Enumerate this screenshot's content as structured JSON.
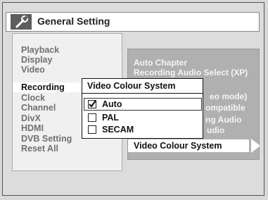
{
  "header": {
    "title": "General Setting",
    "icon": "wrench-icon"
  },
  "menu": {
    "items": [
      "Playback",
      "Display",
      "Video",
      "Recording",
      "Clock",
      "Channel",
      "DivX",
      "HDMI",
      "DVB Setting",
      "Reset All"
    ],
    "active_index": 3
  },
  "submenu": {
    "items_partial": [
      "Auto Chapter",
      "Recording Audio Select (XP)",
      "eo mode)",
      "ompatible",
      "ng Audio",
      "udio"
    ],
    "active_label": "Video Colour System",
    "arrow_icon": "triangle-right-icon"
  },
  "popup": {
    "title": "Video Colour System",
    "options": [
      {
        "label": "Auto",
        "checked": true
      },
      {
        "label": "PAL",
        "checked": false
      },
      {
        "label": "SECAM",
        "checked": false
      }
    ]
  }
}
